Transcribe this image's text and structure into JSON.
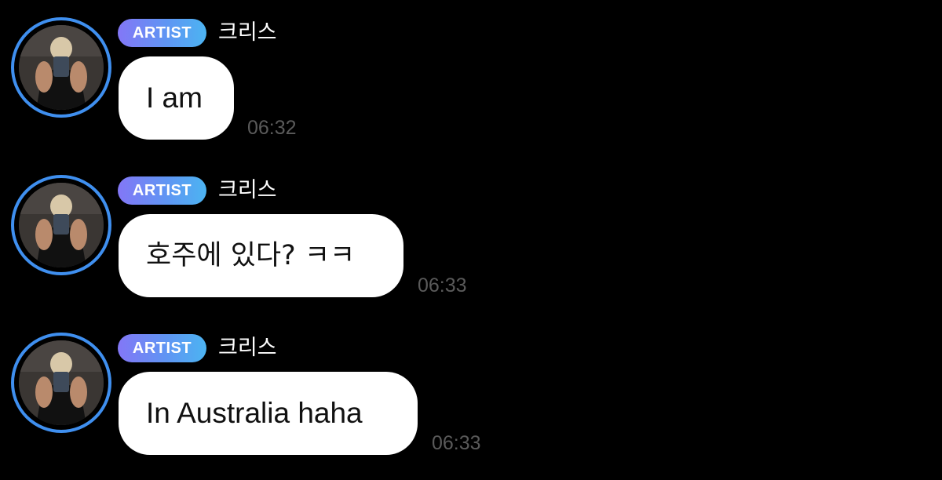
{
  "messages": [
    {
      "badge": "ARTIST",
      "sender": "크리스",
      "text": "I am",
      "time": "06:32"
    },
    {
      "badge": "ARTIST",
      "sender": "크리스",
      "text": "호주에 있다? ㅋㅋ",
      "time": "06:33"
    },
    {
      "badge": "ARTIST",
      "sender": "크리스",
      "text": "In Australia haha",
      "time": "06:33"
    }
  ],
  "colors": {
    "background": "#000000",
    "avatar_ring": "#3f8fef",
    "badge_gradient_start": "#8377f6",
    "badge_gradient_end": "#4cb4f2",
    "bubble": "#ffffff",
    "timestamp": "#5a5a5a"
  },
  "icons": {
    "avatar": "profile-photo"
  }
}
